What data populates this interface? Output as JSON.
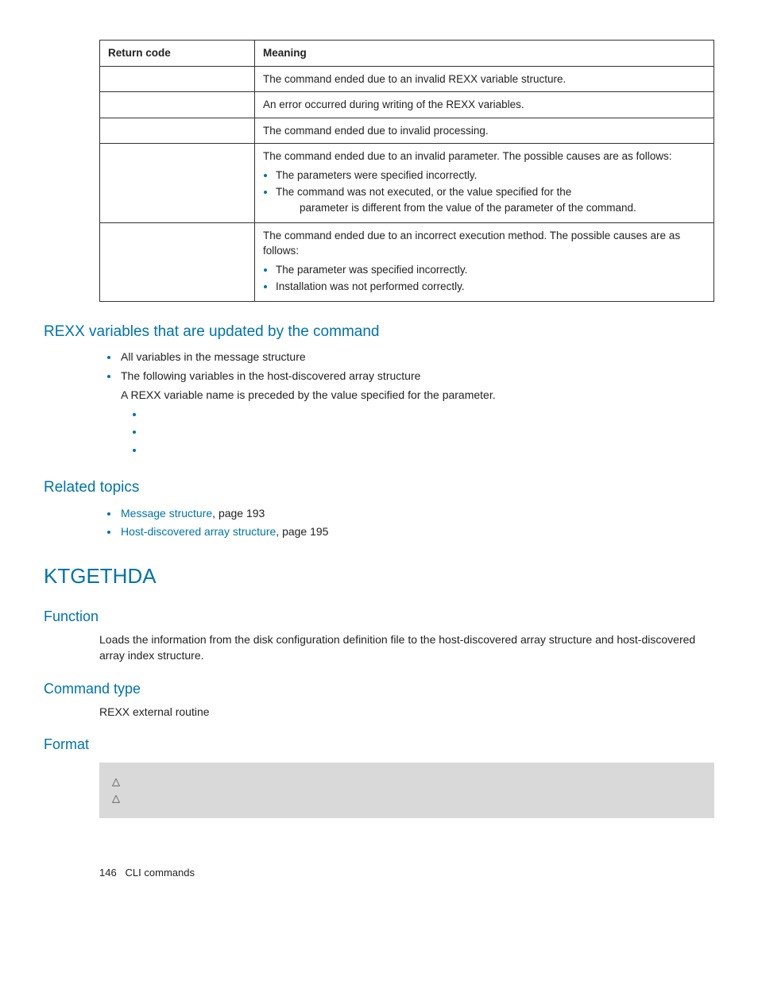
{
  "table": {
    "headers": {
      "code": "Return code",
      "meaning": "Meaning"
    },
    "rows": [
      {
        "code": "",
        "meaning": "The command ended due to an invalid REXX variable structure."
      },
      {
        "code": "",
        "meaning": "An error occurred during writing of the REXX variables."
      },
      {
        "code": "",
        "meaning": "The command ended due to invalid processing."
      },
      {
        "code": "",
        "meaning_intro": "The command ended due to an invalid parameter. The possible causes are as follows:",
        "bullet1": "The parameters were specified incorrectly.",
        "bullet2_a": "The ",
        "bullet2_b": " command was not executed, or the value specified for the ",
        "bullet2_c": " parameter is different from the value of the ",
        "bullet2_d": " parameter of the ",
        "bullet2_e": " command."
      },
      {
        "code": "",
        "meaning_intro": "The command ended due to an incorrect execution method. The possible causes are as follows:",
        "bullet1_a": "The ",
        "bullet1_b": " parameter was specified incorrectly.",
        "bullet2": "Installation was not performed correctly."
      }
    ]
  },
  "section_rexx": {
    "heading_a": "REXX variables that are updated by the ",
    "heading_b": " command",
    "b1": "All variables in the message structure",
    "b2": "The following variables in the host-discovered array structure",
    "b2_para_a": "A REXX variable name is preceded by the value specified for the ",
    "b2_para_b": " parameter.",
    "sub1": "",
    "sub2": "",
    "sub3": ""
  },
  "section_related": {
    "heading": "Related topics",
    "b1_link": "Message structure",
    "b1_suffix": ", page 193",
    "b2_link": "Host-discovered array structure",
    "b2_suffix": ", page 195"
  },
  "section_cmd": {
    "title": "KTGETHDA",
    "function_h": "Function",
    "function_body": "Loads the information from the disk configuration definition file to the host-discovered array structure and host-discovered array index structure.",
    "cmdtype_h": "Command type",
    "cmdtype_body": "REXX external routine",
    "format_h": "Format",
    "codebox_line1": "",
    "codebox_line2": "△",
    "codebox_line3": "△"
  },
  "footer": {
    "page": "146",
    "title": "CLI commands"
  }
}
